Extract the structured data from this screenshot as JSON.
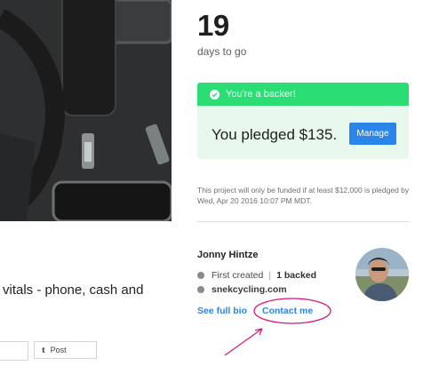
{
  "campaign": {
    "days_number": "19",
    "days_label": "days to go",
    "funding_note": "This project will only be funded if at least $12,000 is pledged by Wed, Apr 20 2016 10:07 PM MDT."
  },
  "backer": {
    "status": "You're a backer!",
    "pledged_text": "You pledged $135.",
    "manage_label": "Manage"
  },
  "creator": {
    "name": "Jonny Hintze",
    "first_created": "First created",
    "backed": "1 backed",
    "website": "snekcycling.com",
    "full_bio_label": "See full bio",
    "contact_label": "Contact me"
  },
  "description": {
    "tagline_fragment": "vitals - phone, cash and"
  },
  "share": {
    "post_icon": "t",
    "post_label": "Post"
  },
  "colors": {
    "backer_green": "#2bde73",
    "backer_bg": "#e8f8ec",
    "link_blue": "#2a85e8",
    "annotation_magenta": "#e0107a"
  }
}
